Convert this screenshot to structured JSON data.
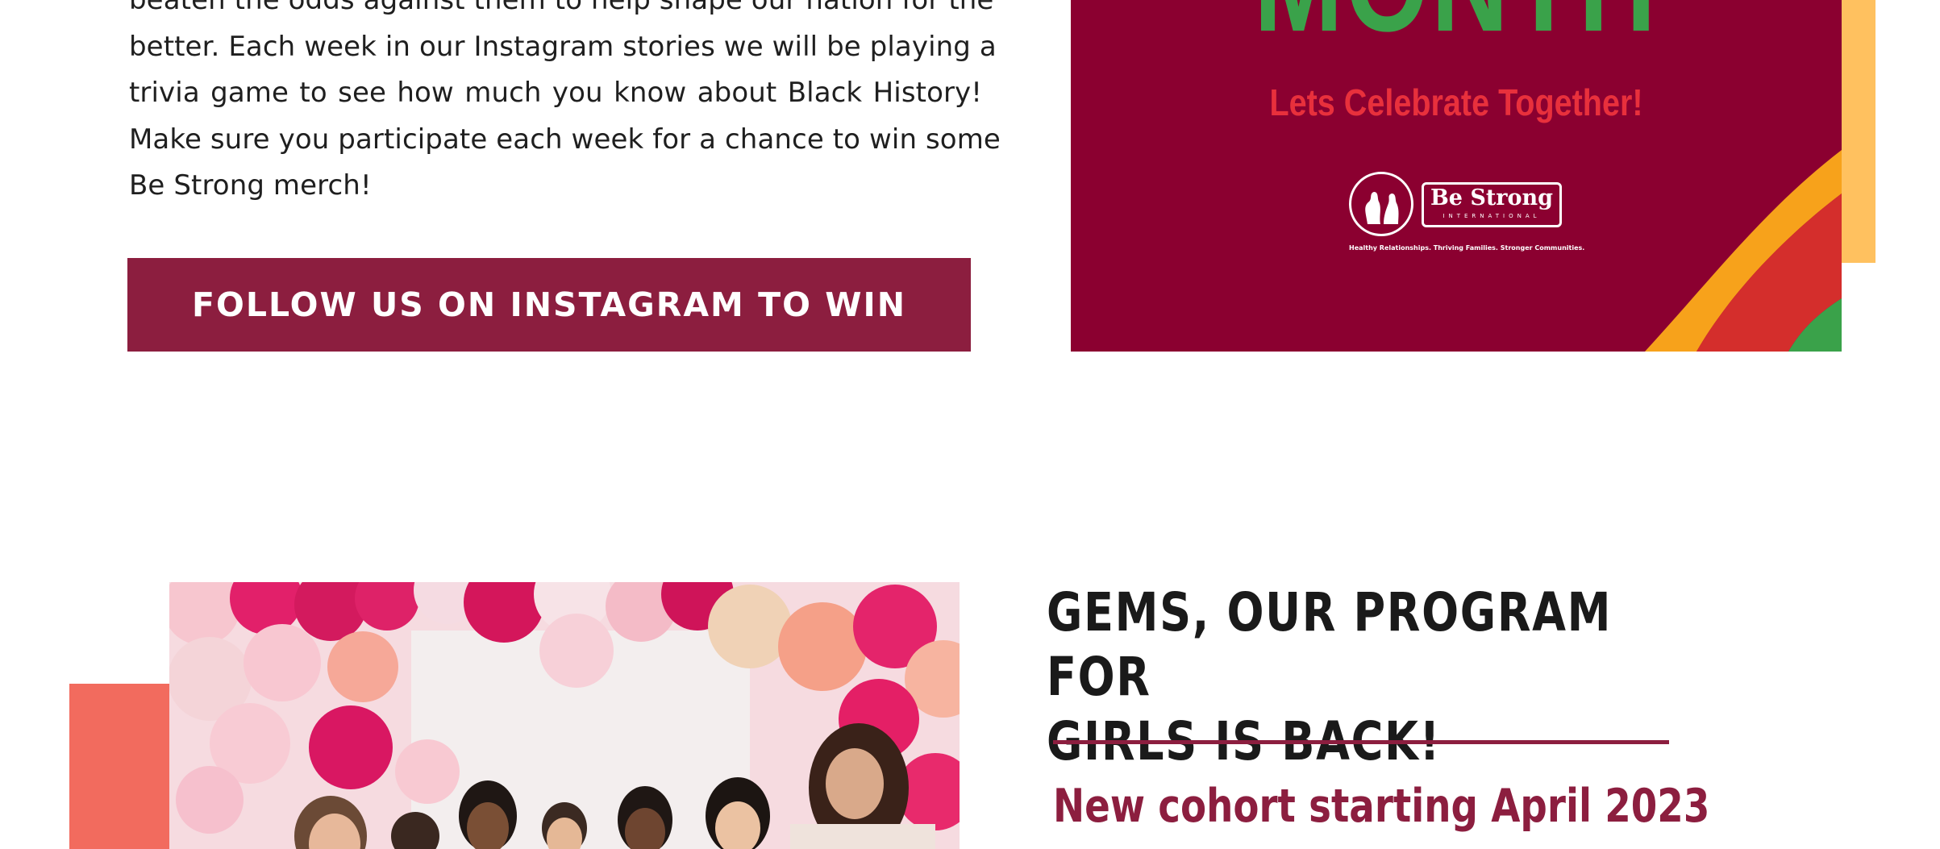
{
  "intro": {
    "lines": [
      "beaten the odds against them to help shape our nation for the",
      "better. Each week in our Instagram stories we will be playing a",
      "trivia game to see how much you know about Black History!",
      "Make sure you participate each week for a chance to win some",
      "Be Strong merch!"
    ],
    "cta_label": "FOLLOW US ON INSTAGRAM TO WIN"
  },
  "banner": {
    "headline": "MONTH",
    "tagline": "Lets Celebrate Together!",
    "logo": {
      "name": "Be Strong",
      "sub": "INTERNATIONAL",
      "motto": "Healthy Relationships. Thriving Families. Stronger Communities."
    },
    "colors": {
      "background": "#8b0030",
      "headline": "#3aa24a",
      "tagline": "#e8303c",
      "stripe_orange": "#f7a21b",
      "stripe_red": "#d42e2c",
      "stripe_green": "#3aa24a",
      "accent_yellow": "#ffc15f"
    }
  },
  "gems": {
    "title_line1": "GEMS, OUR PROGRAM FOR",
    "title_line2": "GIRLS IS BACK!",
    "subtitle": "New cohort starting April 2023",
    "colors": {
      "accent": "#8c1e3f",
      "salmon": "#f26b5e"
    }
  },
  "photo": {
    "icon": "group-photo-balloons"
  }
}
